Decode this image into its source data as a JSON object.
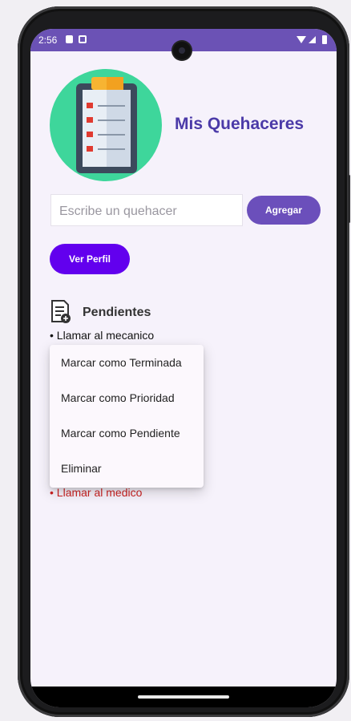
{
  "status_bar": {
    "time": "2:56"
  },
  "app": {
    "title": "Mis Quehaceres"
  },
  "input": {
    "placeholder": "Escribe un quehacer"
  },
  "buttons": {
    "add": "Agregar",
    "profile": "Ver Perfil"
  },
  "section": {
    "title": "Pendientes"
  },
  "tasks": [
    {
      "text": "• Llamar al mecanico"
    },
    {
      "text": "• Llamar al medico"
    }
  ],
  "context_menu": {
    "items": [
      {
        "label": "Marcar como Terminada"
      },
      {
        "label": "Marcar como Prioridad"
      },
      {
        "label": "Marcar como Pendiente"
      },
      {
        "label": "Eliminar"
      }
    ]
  },
  "colors": {
    "status_bar": "#6b52b5",
    "title": "#4b3aa8",
    "add_button": "#6b4fbb",
    "profile_button": "#6200ee",
    "priority_task": "#cc2222"
  }
}
